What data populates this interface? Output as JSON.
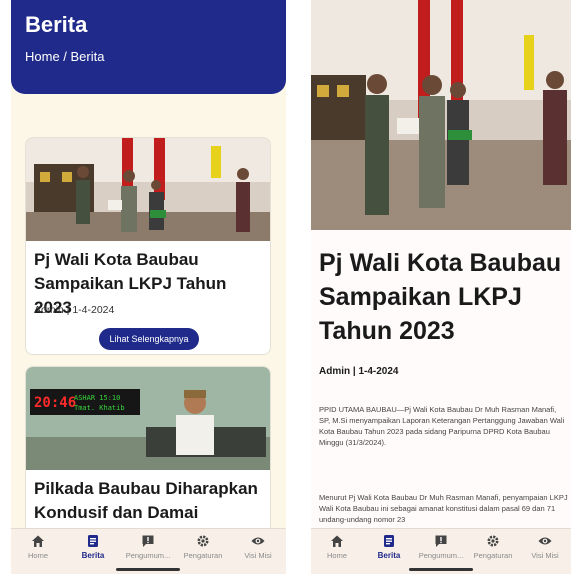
{
  "list_screen": {
    "header": {
      "title": "Berita",
      "breadcrumb": "Home / Berita"
    },
    "cards": [
      {
        "title": "Pj Wali Kota Baubau Sampaikan LKPJ Tahun 2023",
        "meta": "Admin | 1-4-2024",
        "button_label": "Lihat Selengkapnya"
      },
      {
        "title": "Pilkada Baubau Diharapkan Kondusif dan Damai",
        "led_time": "20:46",
        "led_text": "ASHAR 15:10",
        "led_text2": "Tmat. Khatib"
      }
    ]
  },
  "detail_screen": {
    "title": "Pj Wali Kota Baubau Sampaikan LKPJ Tahun 2023",
    "meta": "Admin | 1-4-2024",
    "paragraph_1": "PPID UTAMA BAUBAU—Pj Wali Kota Baubau Dr Muh Rasman Manafi, SP, M.Si menyampaikan Laporan Keterangan Pertanggung Jawaban Wali Kota Baubau Tahun 2023 pada sidang Paripurna DPRD Kota Baubau Minggu (31/3/2024).",
    "paragraph_2": "Menurut Pj Wali Kota Baubau Dr Muh Rasman Manafi, penyampaian LKPJ Wali Kota Baubau ini sebagai amanat konstitusi dalam pasal 69 dan 71 undang-undang nomor 23"
  },
  "bottom_nav": {
    "items": [
      {
        "label": "Home",
        "icon": "home-icon"
      },
      {
        "label": "Berita",
        "icon": "news-icon"
      },
      {
        "label": "Pengumum...",
        "icon": "announcement-icon"
      },
      {
        "label": "Pengaturan",
        "icon": "gear-icon"
      },
      {
        "label": "Visi Misi",
        "icon": "eye-icon"
      }
    ],
    "active": "Berita"
  },
  "colors": {
    "primary": "#1f2a8a",
    "background": "#fdf7e8",
    "card": "#ffffff",
    "nav_background": "#f7efe8"
  }
}
